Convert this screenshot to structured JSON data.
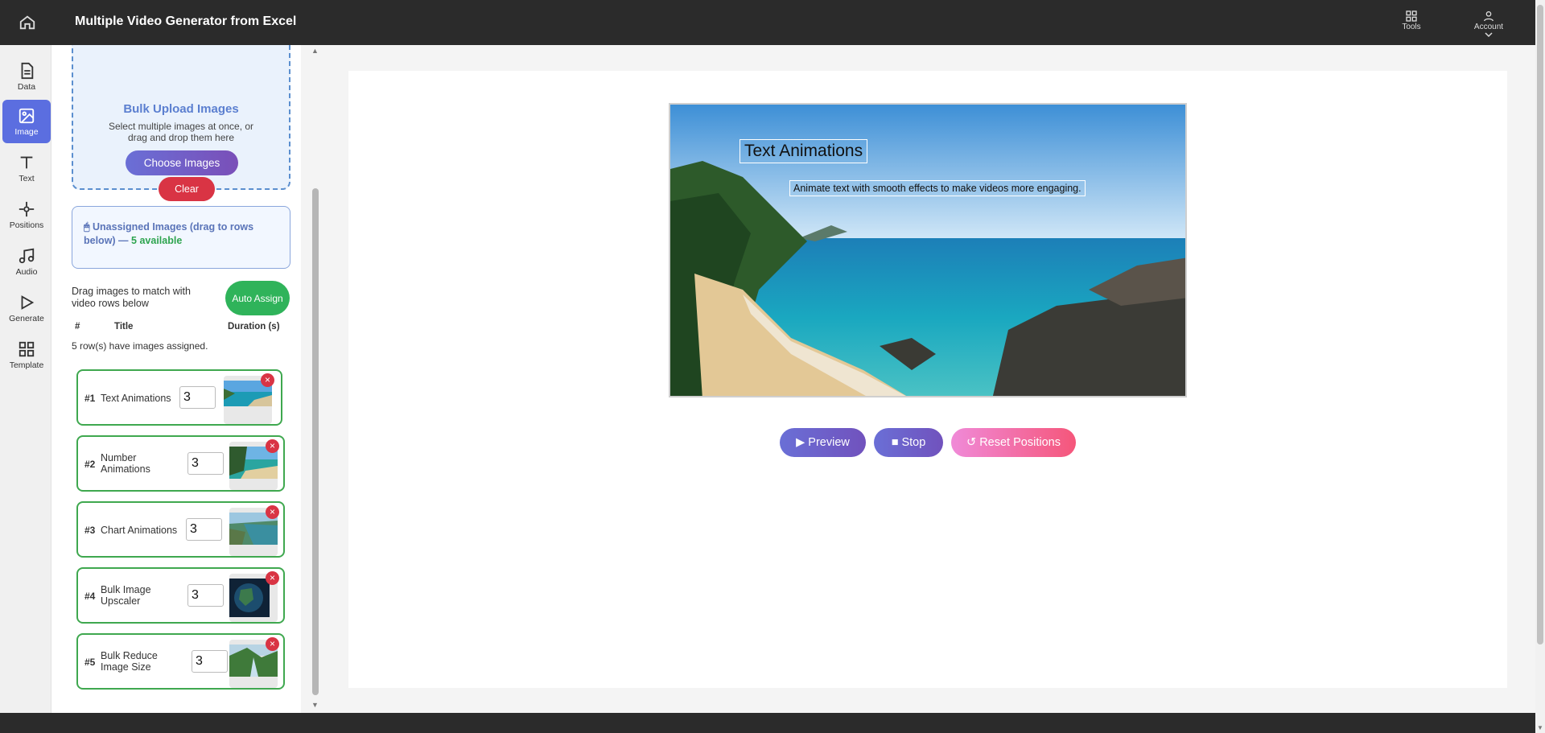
{
  "app": {
    "title": "Multiple Video Generator from Excel"
  },
  "topbar": {
    "tools_label": "Tools",
    "account_label": "Account"
  },
  "nav": {
    "items": [
      {
        "label": "Data",
        "icon": "document-icon"
      },
      {
        "label": "Image",
        "icon": "image-icon",
        "active": true
      },
      {
        "label": "Text",
        "icon": "text-icon"
      },
      {
        "label": "Positions",
        "icon": "positions-icon"
      },
      {
        "label": "Audio",
        "icon": "music-icon"
      },
      {
        "label": "Generate",
        "icon": "play-icon"
      },
      {
        "label": "Template",
        "icon": "grid-icon"
      }
    ]
  },
  "upload": {
    "title": "Bulk Upload Images",
    "description": "Select multiple images at once, or drag and drop them here",
    "choose_label": "Choose Images",
    "clear_label": "Clear"
  },
  "unassigned": {
    "icon": "🖱",
    "label": "Unassigned Images (drag to rows below) —",
    "available": "5 available"
  },
  "assign": {
    "instruction": "Drag images to match with video rows below",
    "auto_assign_label": "Auto Assign",
    "columns": [
      "#",
      "Title",
      "Duration (s)"
    ],
    "assigned_note": "5 row(s) have images assigned."
  },
  "rows": [
    {
      "num": "#1",
      "title": "Text Animations",
      "duration": "3",
      "remove_label": "×"
    },
    {
      "num": "#2",
      "title": "Number Animations",
      "duration": "3",
      "remove_label": "×"
    },
    {
      "num": "#3",
      "title": "Chart Animations",
      "duration": "3",
      "remove_label": "×"
    },
    {
      "num": "#4",
      "title": "Bulk Image Upscaler",
      "duration": "3",
      "remove_label": "×"
    },
    {
      "num": "#5",
      "title": "Bulk Reduce Image Size",
      "duration": "3",
      "remove_label": "×"
    }
  ],
  "preview": {
    "title": "Text Animations",
    "subtitle": "Animate text with smooth effects to make videos more engaging."
  },
  "controls": {
    "preview_label": "▶ Preview",
    "stop_label": "■ Stop",
    "reset_label": "↺ Reset Positions"
  },
  "colors": {
    "accent": "#5b6ee0",
    "success": "#2fb35a",
    "danger": "#d93444",
    "topbar": "#2b2b2b"
  }
}
